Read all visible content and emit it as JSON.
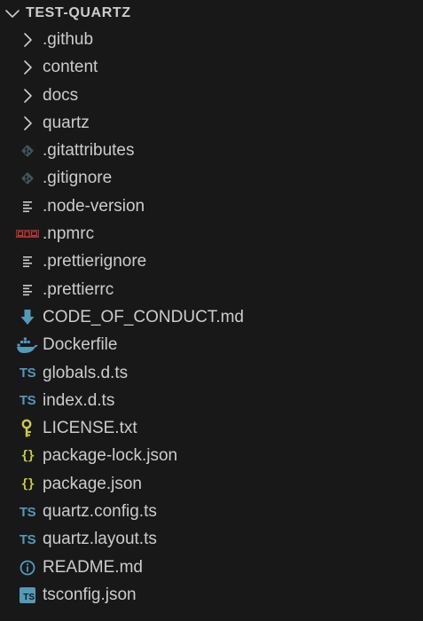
{
  "explorer": {
    "title": "TEST-QUARTZ"
  },
  "colors": {
    "background": "#181818",
    "text": "#cccccc",
    "chevron": "#cccccc",
    "git": "#41535b",
    "npm": "#cb3837",
    "markdown": "#519aba",
    "docker": "#519aba",
    "typescript": "#519aba",
    "json": "#cbcb41",
    "license": "#cbcb41",
    "lines": "#cccccc"
  },
  "items": [
    {
      "label": ".github",
      "type": "folder",
      "icon": "chevron-right-icon"
    },
    {
      "label": "content",
      "type": "folder",
      "icon": "chevron-right-icon"
    },
    {
      "label": "docs",
      "type": "folder",
      "icon": "chevron-right-icon"
    },
    {
      "label": "quartz",
      "type": "folder",
      "icon": "chevron-right-icon"
    },
    {
      "label": ".gitattributes",
      "type": "file",
      "icon": "git-icon"
    },
    {
      "label": ".gitignore",
      "type": "file",
      "icon": "git-icon"
    },
    {
      "label": ".node-version",
      "type": "file",
      "icon": "text-lines-icon"
    },
    {
      "label": ".npmrc",
      "type": "file",
      "icon": "npm-icon"
    },
    {
      "label": ".prettierignore",
      "type": "file",
      "icon": "text-lines-icon"
    },
    {
      "label": ".prettierrc",
      "type": "file",
      "icon": "text-lines-icon"
    },
    {
      "label": "CODE_OF_CONDUCT.md",
      "type": "file",
      "icon": "markdown-download-icon"
    },
    {
      "label": "Dockerfile",
      "type": "file",
      "icon": "docker-whale-icon"
    },
    {
      "label": "globals.d.ts",
      "type": "file",
      "icon": "typescript-icon",
      "icon_text": "TS"
    },
    {
      "label": "index.d.ts",
      "type": "file",
      "icon": "typescript-icon",
      "icon_text": "TS"
    },
    {
      "label": "LICENSE.txt",
      "type": "file",
      "icon": "license-key-icon"
    },
    {
      "label": "package-lock.json",
      "type": "file",
      "icon": "json-braces-icon",
      "icon_text": "{}"
    },
    {
      "label": "package.json",
      "type": "file",
      "icon": "json-braces-icon",
      "icon_text": "{}"
    },
    {
      "label": "quartz.config.ts",
      "type": "file",
      "icon": "typescript-icon",
      "icon_text": "TS"
    },
    {
      "label": "quartz.layout.ts",
      "type": "file",
      "icon": "typescript-icon",
      "icon_text": "TS"
    },
    {
      "label": "README.md",
      "type": "file",
      "icon": "info-circle-icon"
    },
    {
      "label": "tsconfig.json",
      "type": "file",
      "icon": "tsconfig-icon",
      "icon_text": "TS"
    }
  ]
}
